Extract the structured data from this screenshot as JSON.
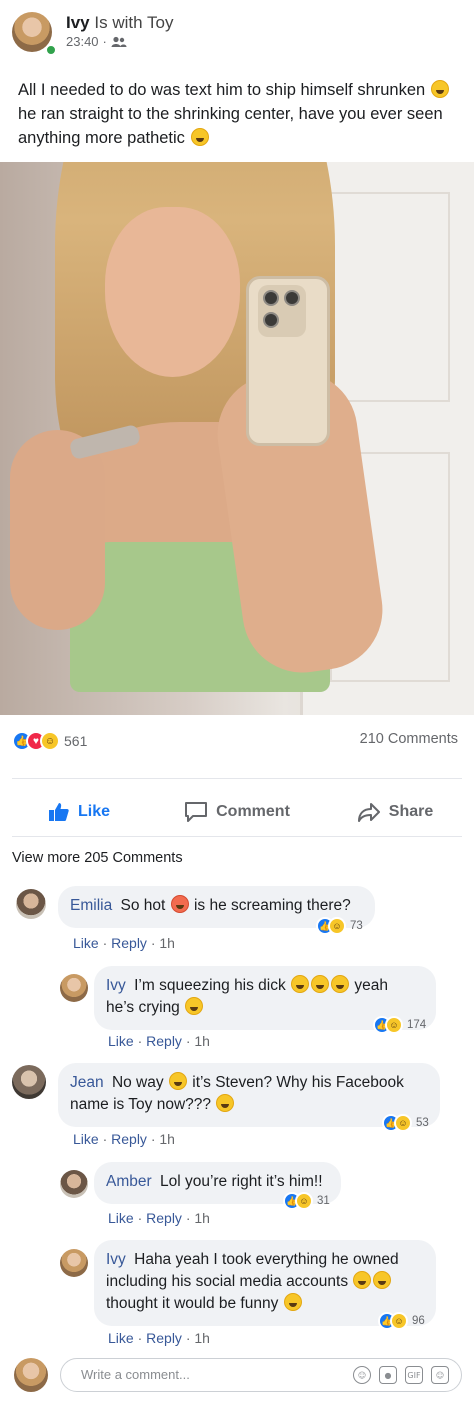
{
  "post": {
    "author": "Ivy",
    "with_text": "Is with",
    "with_name": "Toy",
    "time": "23:40",
    "separator": "·",
    "text_line1": "All I needed to do was text him to ship himself shrunken",
    "text_line2": "he ran straight to the shrinking center, have you ever seen",
    "text_line3": "anything more pathetic",
    "reactions_count": "561",
    "comments_count": "210 Comments"
  },
  "actions": {
    "like": "Like",
    "comment": "Comment",
    "share": "Share"
  },
  "view_more": "View more 205 Comments",
  "comments": [
    {
      "author": "Emilia",
      "text_a": "So hot",
      "text_b": "is he screaming there?",
      "like": "Like",
      "reply": "Reply",
      "time": "1h",
      "reactions": "73"
    },
    {
      "author": "Ivy",
      "text_a": "I’m squeezing his dick",
      "text_b": "yeah",
      "text_c": "he’s crying",
      "like": "Like",
      "reply": "Reply",
      "time": "1h",
      "reactions": "174"
    },
    {
      "author": "Jean",
      "text_a": "No way",
      "text_b": "it’s Steven? Why his Facebook",
      "text_c": "name is Toy now???",
      "like": "Like",
      "reply": "Reply",
      "time": "1h",
      "reactions": "53"
    },
    {
      "author": "Amber",
      "text_a": "Lol you’re right it’s him!!",
      "like": "Like",
      "reply": "Reply",
      "time": "1h",
      "reactions": "31"
    },
    {
      "author": "Ivy",
      "text_a": "Haha yeah I took everything he owned",
      "text_b": "including his social media accounts",
      "text_c": "thought it would be funny",
      "like": "Like",
      "reply": "Reply",
      "time": "1h",
      "reactions": "96"
    }
  ],
  "composer": {
    "placeholder": "Write a comment...",
    "gif": "GIF"
  },
  "colors": {
    "link": "#385898",
    "like_blue": "#1877f2",
    "love_red": "#f02849",
    "online_green": "#31a24c"
  }
}
